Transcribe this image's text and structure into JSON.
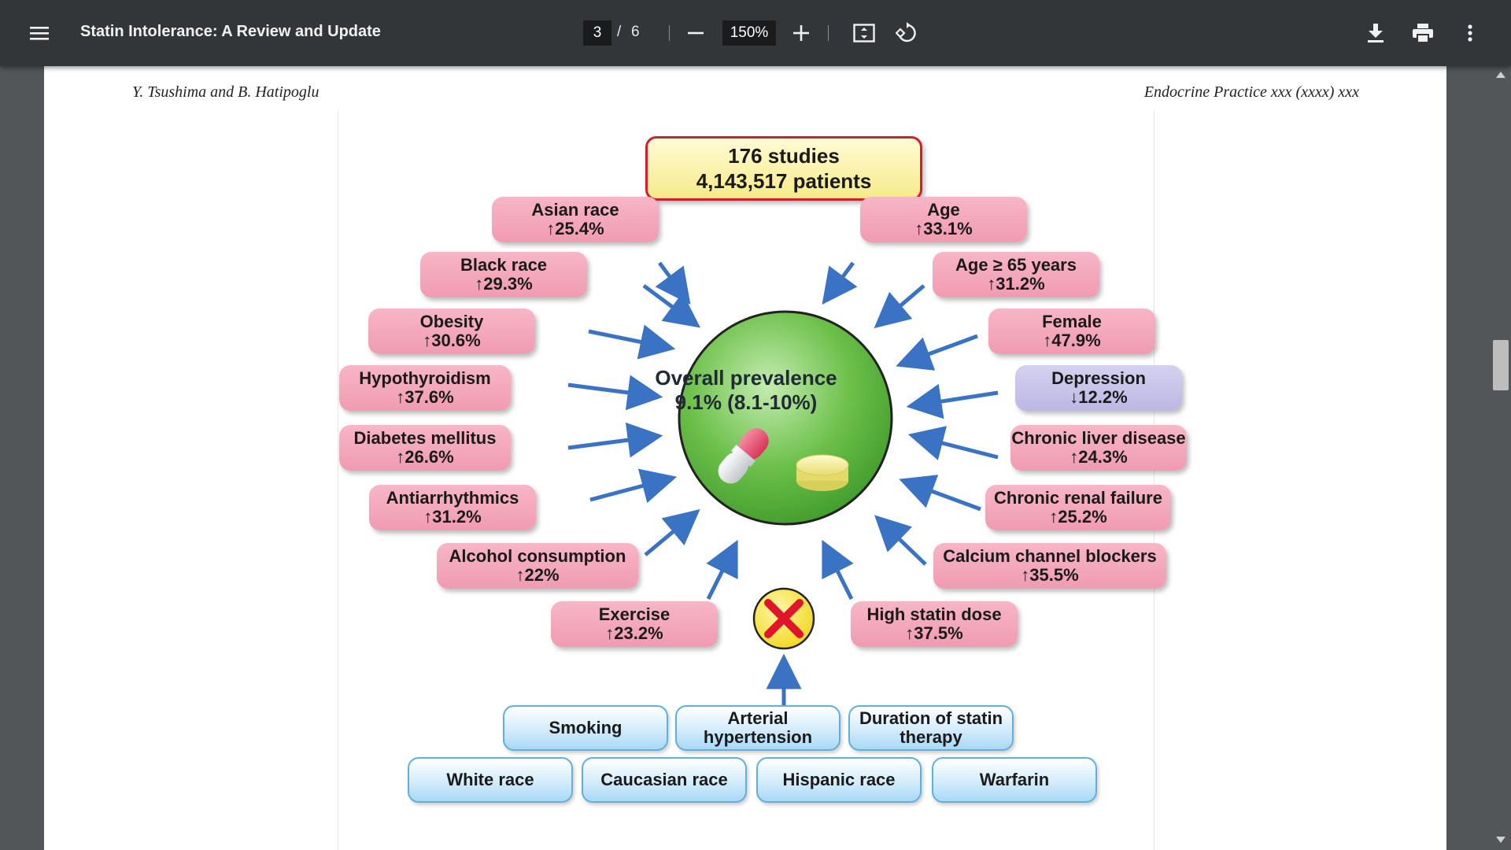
{
  "viewer": {
    "title": "Statin Intolerance: A Review and Update",
    "current_page": "3",
    "page_separator": "/",
    "total_pages": "6",
    "zoom": "150%"
  },
  "document": {
    "running_head_left": "Y. Tsushima and B. Hatipoglu",
    "running_head_right": "Endocrine Practice xxx (xxxx) xxx"
  },
  "figure": {
    "summary": {
      "line1": "176 studies",
      "line2": "4,143,517 patients"
    },
    "center": {
      "line1": "Overall prevalence",
      "line2": "9.1% (8.1-10%)"
    },
    "left_factors": [
      {
        "name": "Asian race",
        "value": "↑25.4%"
      },
      {
        "name": "Black race",
        "value": "↑29.3%"
      },
      {
        "name": "Obesity",
        "value": "↑30.6%"
      },
      {
        "name": "Hypothyroidism",
        "value": "↑37.6%"
      },
      {
        "name": "Diabetes mellitus",
        "value": "↑26.6%"
      },
      {
        "name": "Antiarrhythmics",
        "value": "↑31.2%"
      },
      {
        "name": "Alcohol consumption",
        "value": "↑22%"
      },
      {
        "name": "Exercise",
        "value": "↑23.2%"
      }
    ],
    "right_factors": [
      {
        "name": "Age",
        "value": "↑33.1%"
      },
      {
        "name": "Age ≥ 65 years",
        "value": "↑31.2%"
      },
      {
        "name": "Female",
        "value": "↑47.9%"
      },
      {
        "name": "Depression",
        "value": "↓12.2%"
      },
      {
        "name": "Chronic liver disease",
        "value": "↑24.3%"
      },
      {
        "name": "Chronic renal failure",
        "value": "↑25.2%"
      },
      {
        "name": "Calcium channel blockers",
        "value": "↑35.5%"
      },
      {
        "name": "High statin dose",
        "value": "↑37.5%"
      }
    ],
    "no_effect_row1": [
      {
        "l1": "Smoking",
        "l2": ""
      },
      {
        "l1": "Arterial",
        "l2": "hypertension"
      },
      {
        "l1": "Duration of statin",
        "l2": "therapy"
      }
    ],
    "no_effect_row2": [
      "White race",
      "Caucasian race",
      "Hispanic race",
      "Warfarin"
    ]
  },
  "colors": {
    "toolbar_bg": "#323639",
    "risk_box": "#f4a8bb",
    "protective_box": "#c9c5eb",
    "no_effect_box": "#cfe9fb",
    "arrow": "#3a72c4",
    "center_circle": "#6cc04a"
  },
  "icons": [
    "menu-icon",
    "zoom-out-icon",
    "zoom-in-icon",
    "fit-page-icon",
    "rotate-icon",
    "download-icon",
    "print-icon",
    "more-vert-icon",
    "no-effect-x-icon",
    "capsule-icon",
    "tablet-icon"
  ]
}
